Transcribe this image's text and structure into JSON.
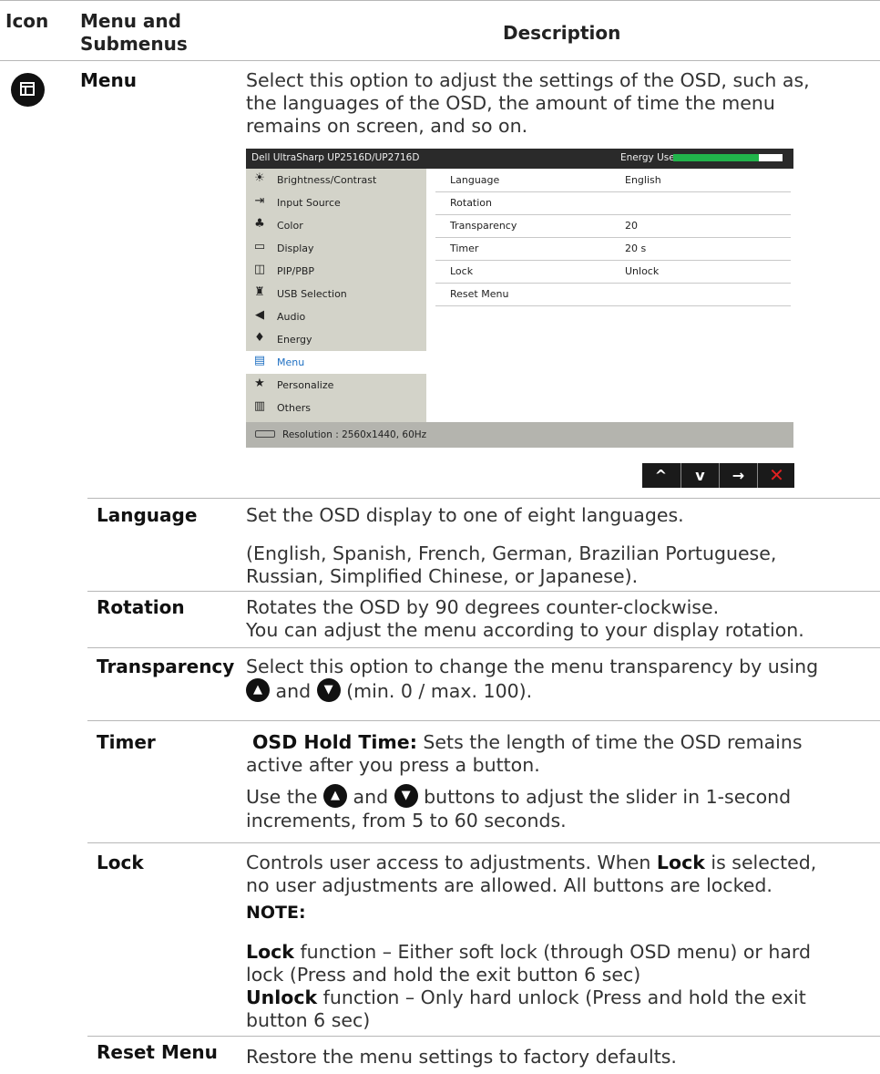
{
  "header": {
    "icon": "Icon",
    "menu_line1": "Menu and",
    "menu_line2": "Submenus",
    "description": "Description"
  },
  "menu_icon": "menu-window-icon",
  "menu": {
    "label": "Menu",
    "desc_line1": "Select this option to adjust the settings of the OSD, such as,",
    "desc_line2": "the languages of the OSD, the amount of time the menu",
    "desc_line3": "remains on screen, and so on."
  },
  "osd": {
    "title": "Dell UltraSharp UP2516D/UP2716D",
    "energy_label": "Energy Use",
    "energy_level": 0.78,
    "energy_color": "#21b44b",
    "left_items": [
      {
        "icon": "sun-icon",
        "glyph": "☀",
        "label": "Brightness/Contrast"
      },
      {
        "icon": "input-source-icon",
        "glyph": "⇥",
        "label": "Input Source"
      },
      {
        "icon": "color-icon",
        "glyph": "♣",
        "label": "Color"
      },
      {
        "icon": "display-icon",
        "glyph": "▭",
        "label": "Display"
      },
      {
        "icon": "pip-icon",
        "glyph": "◫",
        "label": "PIP/PBP"
      },
      {
        "icon": "usb-icon",
        "glyph": "♜",
        "label": "USB Selection"
      },
      {
        "icon": "audio-icon",
        "glyph": "◀",
        "label": "Audio"
      },
      {
        "icon": "energy-icon",
        "glyph": "♦",
        "label": "Energy"
      },
      {
        "icon": "menu-icon",
        "glyph": "▤",
        "label": "Menu"
      },
      {
        "icon": "star-icon",
        "glyph": "★",
        "label": "Personalize"
      },
      {
        "icon": "others-icon",
        "glyph": "▥",
        "label": "Others"
      }
    ],
    "right_rows": [
      {
        "key": "Language",
        "value": "English"
      },
      {
        "key": "Rotation",
        "value": ""
      },
      {
        "key": "Transparency",
        "value": "20"
      },
      {
        "key": "Timer",
        "value": "20 s"
      },
      {
        "key": "Lock",
        "value": "Unlock"
      },
      {
        "key": "Reset Menu",
        "value": ""
      }
    ],
    "footer": "Resolution : 2560x1440, 60Hz"
  },
  "nav_buttons": [
    "^",
    "v",
    "→",
    "✕"
  ],
  "language": {
    "label": "Language",
    "desc1": "Set the OSD display to one of eight languages.",
    "desc2_line1": "(English, Spanish, French, German, Brazilian Portuguese,",
    "desc2_line2": "Russian, Simplified Chinese, or Japanese)."
  },
  "rotation": {
    "label": "Rotation",
    "desc_line1": "Rotates the OSD by 90 degrees counter-clockwise.",
    "desc_line2": "You can adjust the menu according to your display rotation."
  },
  "transparency": {
    "label": "Transparency",
    "desc_line1": "Select this option to change the menu transparency by using",
    "and": "and",
    "range": "(min. 0 / max. 100)."
  },
  "timer": {
    "label": "Timer",
    "bold": "OSD Hold Time:",
    "desc1_rest": " Sets the length of time the OSD remains",
    "desc1_line2": "active after you press a button.",
    "use_the": "Use the",
    "and": "and",
    "buttons_rest": "buttons to adjust the slider in 1-second",
    "desc2_line2": "increments, from 5 to 60 seconds."
  },
  "lock": {
    "label": "Lock",
    "desc_a": "Controls user access to adjustments. When ",
    "desc_bold": "Lock",
    "desc_b": " is selected,",
    "desc_line2": "no user adjustments are allowed. All buttons are locked.",
    "note": "NOTE:",
    "lock_bold": "Lock",
    "lock_rest": " function – Either soft lock (through OSD menu) or hard",
    "lock_line2": "lock (Press and hold the exit button 6 sec)",
    "unlock_bold": "Unlock",
    "unlock_rest": " function – Only hard unlock (Press and hold the exit",
    "unlock_line2": "button 6 sec)"
  },
  "reset": {
    "label": "Reset Menu",
    "desc": "Restore the menu settings to factory defaults."
  }
}
